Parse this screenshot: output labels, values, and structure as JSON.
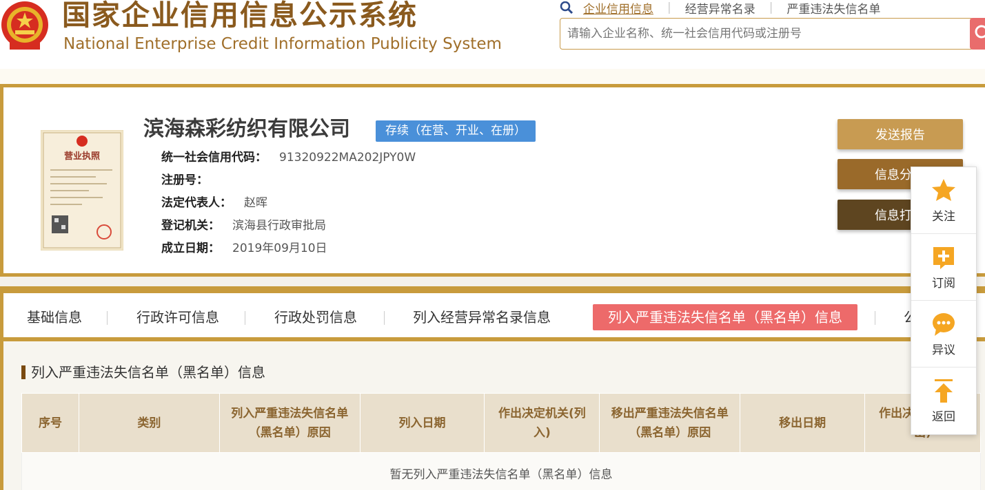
{
  "header": {
    "logo_cn": "国家企业信用信息公示系统",
    "logo_en": "National Enterprise Credit Information Publicity System",
    "nav": [
      {
        "label": "企业信用信息"
      },
      {
        "label": "经营异常名录"
      },
      {
        "label": "严重违法失信名单"
      }
    ],
    "search_placeholder": "请输入企业名称、统一社会信用代码或注册号"
  },
  "company": {
    "name": "滨海森彩纺织有限公司",
    "status": "存续（在营、开业、在册）",
    "fields": [
      {
        "label": "统一社会信用代码：",
        "value": "91320922MA202JPY0W"
      },
      {
        "label": "注册号：",
        "value": ""
      },
      {
        "label": "法定代表人：",
        "value": "赵晖"
      },
      {
        "label": "登记机关：",
        "value": "滨海县行政审批局"
      },
      {
        "label": "成立日期：",
        "value": "2019年09月10日"
      }
    ],
    "license_title": "营业执照"
  },
  "actions": {
    "send_report": "发送报告",
    "share": "信息分",
    "print": "信息打"
  },
  "tabs": [
    {
      "label": "基础信息"
    },
    {
      "label": "行政许可信息"
    },
    {
      "label": "行政处罚信息"
    },
    {
      "label": "列入经营异常名录信息"
    },
    {
      "label": "列入严重违法失信名单（黑名单）信息"
    },
    {
      "label": "公"
    }
  ],
  "section": {
    "title": "列入严重违法失信名单（黑名单）信息",
    "columns": [
      "序号",
      "类别",
      "列入严重违法失信名单（黑名单）原因",
      "列入日期",
      "作出决定机关(列入)",
      "移出严重违法失信名单（黑名单）原因",
      "移出日期",
      "作出决定机关(移出)"
    ],
    "empty_text": "暂无列入严重违法失信名单（黑名单）信息"
  },
  "float_bar": [
    {
      "label": "关注",
      "icon": "star-icon"
    },
    {
      "label": "订阅",
      "icon": "subscribe-icon"
    },
    {
      "label": "异议",
      "icon": "chat-bubble-icon"
    },
    {
      "label": "返回",
      "icon": "back-to-top-icon"
    }
  ],
  "colors": {
    "brand_gold": "#c89b3c",
    "brand_brown": "#8a5a1e",
    "active_tab": "#ed6a6a",
    "status_blue": "#4a90d9",
    "icon_orange": "#f5a623"
  }
}
